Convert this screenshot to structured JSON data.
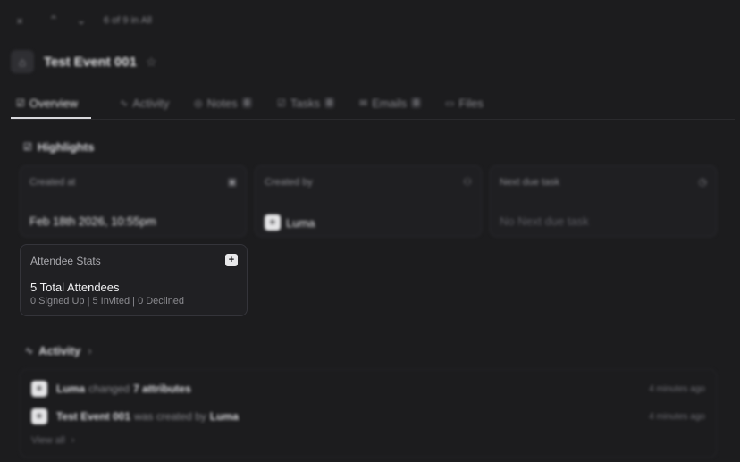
{
  "topbar": {
    "close_icon": "×",
    "up_icon": "⌃",
    "down_icon": "⌄",
    "counter": "6 of 9 in All"
  },
  "header": {
    "object_icon": "⌂",
    "title": "Test Event 001",
    "star_icon": "☆"
  },
  "tabs": [
    {
      "label": "Overview",
      "icon": "☑",
      "active": true
    },
    {
      "label": "Activity",
      "icon": "∿"
    },
    {
      "label": "Notes",
      "icon": "◎",
      "count": "0"
    },
    {
      "label": "Tasks",
      "icon": "☑",
      "count": "0"
    },
    {
      "label": "Emails",
      "icon": "✉",
      "count": "0"
    },
    {
      "label": "Files",
      "icon": "▭"
    }
  ],
  "highlights": {
    "title": "Highlights",
    "icon": "☑",
    "cards": [
      {
        "label": "Created at",
        "icon": "▣",
        "value": "Feb 18th 2026, 10:55pm"
      },
      {
        "label": "Created by",
        "icon": "⚇",
        "value": "Luma",
        "avatar": "✳"
      },
      {
        "label": "Next due task",
        "icon": "◷",
        "value": "No Next due task"
      }
    ]
  },
  "attendee_stats": {
    "label": "Attendee Stats",
    "add_icon": "+",
    "total": "5 Total Attendees",
    "detail": "0 Signed Up | 5 Invited | 0 Declined"
  },
  "activity": {
    "title": "Activity",
    "icon": "∿",
    "chevron": "›",
    "rows": [
      {
        "actor": "Luma",
        "verb": "changed",
        "object": "7 attributes",
        "time": "4 minutes ago"
      },
      {
        "actor": "Test Event 001",
        "verb": "was created by",
        "object": "Luma",
        "time": "4 minutes ago"
      }
    ],
    "view_all": "View all",
    "view_all_chevron": "›"
  },
  "colors": {
    "background": "#1c1c1e",
    "card_border": "#2c2c30",
    "text_primary": "#e8e8ea",
    "text_muted": "#8a8a8f"
  }
}
